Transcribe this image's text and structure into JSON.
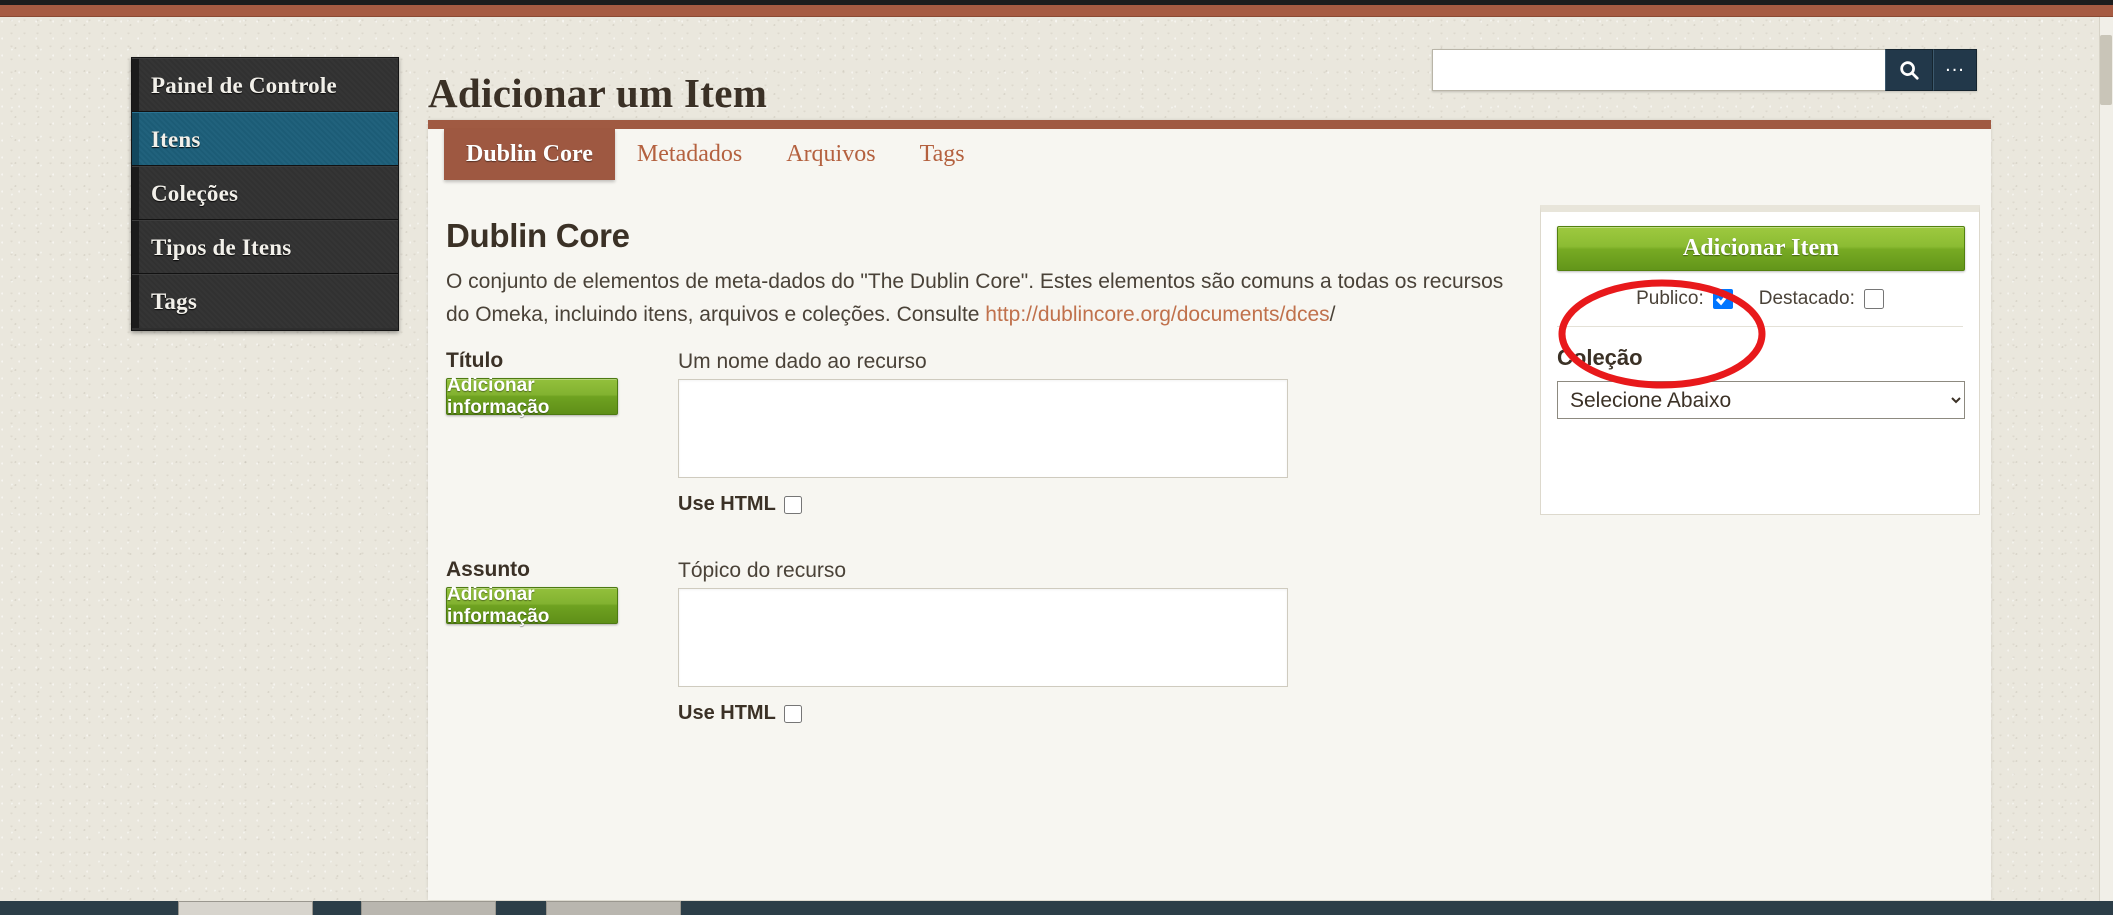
{
  "window": {
    "title": "Adicionar um Item"
  },
  "sidebar": {
    "items": [
      {
        "label": "Painel de Controle",
        "active": false
      },
      {
        "label": "Itens",
        "active": true
      },
      {
        "label": "Coleções",
        "active": false
      },
      {
        "label": "Tipos de Itens",
        "active": false
      },
      {
        "label": "Tags",
        "active": false
      }
    ]
  },
  "search": {
    "value": "",
    "placeholder": "",
    "search_icon": "search-icon",
    "advanced_label": "..."
  },
  "tabs": [
    {
      "label": "Dublin Core",
      "active": true
    },
    {
      "label": "Metadados",
      "active": false
    },
    {
      "label": "Arquivos",
      "active": false
    },
    {
      "label": "Tags",
      "active": false
    }
  ],
  "main": {
    "heading": "Dublin Core",
    "description_part1": "O conjunto de elementos de meta-dados do \"The Dublin Core\". Estes elementos são comuns a todas os recursos do Omeka, incluindo itens, arquivos e coleções. Consulte ",
    "description_link": "http://dublincore.org/documents/dces",
    "description_part2": "/",
    "fields": [
      {
        "label": "Título",
        "add_button": "Adicionar informação",
        "hint": "Um nome dado ao recurso",
        "value": "",
        "use_html_label": "Use HTML",
        "use_html_checked": false
      },
      {
        "label": "Assunto",
        "add_button": "Adicionar informação",
        "hint": "Tópico do recurso",
        "value": "",
        "use_html_label": "Use HTML",
        "use_html_checked": false
      }
    ]
  },
  "side_panel": {
    "primary_button": "Adicionar Item",
    "public_label": "Publico:",
    "public_checked": true,
    "featured_label": "Destacado:",
    "featured_checked": false,
    "collection_label": "Coleção",
    "collection_selected": "Selecione Abaixo",
    "collection_options": [
      "Selecione Abaixo"
    ]
  },
  "colors": {
    "accent_rust": "#a05a42",
    "nav_active_blue": "#1d5f7a",
    "button_green": "#82b230",
    "annotation_red": "#e8191b",
    "page_background": "#eae7dd",
    "link": "#c0714c"
  }
}
